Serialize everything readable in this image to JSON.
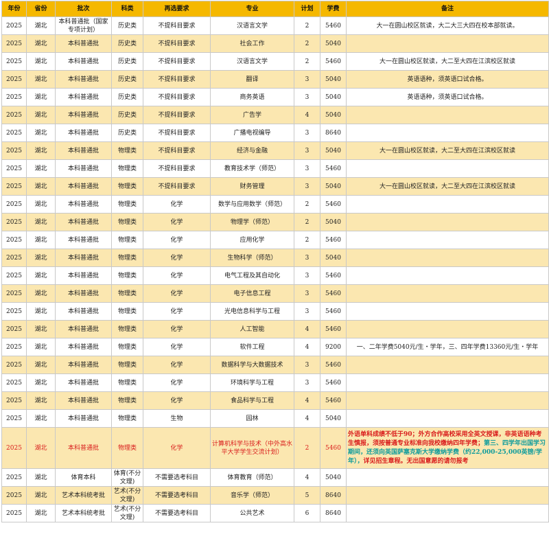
{
  "header": {
    "year": "年份",
    "province": "省份",
    "batch": "批次",
    "subject_type": "科类",
    "reselect": "再选要求",
    "major": "专业",
    "plan": "计划",
    "tuition": "学费",
    "note": "备注"
  },
  "rows": [
    {
      "year": "2025",
      "province": "湖北",
      "batch": "本科普通批（国家专项计划）",
      "subject_type": "历史类",
      "reselect": "不提科目要求",
      "major": "汉语言文学",
      "plan": "2",
      "tuition": "5460",
      "note": "大一在圆山校区就读，大二大三大四在校本部就读。"
    },
    {
      "year": "2025",
      "province": "湖北",
      "batch": "本科普通批",
      "subject_type": "历史类",
      "reselect": "不提科目要求",
      "major": "社会工作",
      "plan": "2",
      "tuition": "5040",
      "note": ""
    },
    {
      "year": "2025",
      "province": "湖北",
      "batch": "本科普通批",
      "subject_type": "历史类",
      "reselect": "不提科目要求",
      "major": "汉语言文学",
      "plan": "2",
      "tuition": "5460",
      "note": "大一在圆山校区就读，大二至大四在江滨校区就读"
    },
    {
      "year": "2025",
      "province": "湖北",
      "batch": "本科普通批",
      "subject_type": "历史类",
      "reselect": "不提科目要求",
      "major": "翻译",
      "plan": "3",
      "tuition": "5040",
      "note": "英语语种，须英语口试合格。"
    },
    {
      "year": "2025",
      "province": "湖北",
      "batch": "本科普通批",
      "subject_type": "历史类",
      "reselect": "不提科目要求",
      "major": "商务英语",
      "plan": "3",
      "tuition": "5040",
      "note": "英语语种，须英语口试合格。"
    },
    {
      "year": "2025",
      "province": "湖北",
      "batch": "本科普通批",
      "subject_type": "历史类",
      "reselect": "不提科目要求",
      "major": "广告学",
      "plan": "4",
      "tuition": "5040",
      "note": ""
    },
    {
      "year": "2025",
      "province": "湖北",
      "batch": "本科普通批",
      "subject_type": "历史类",
      "reselect": "不提科目要求",
      "major": "广播电视编导",
      "plan": "3",
      "tuition": "8640",
      "note": ""
    },
    {
      "year": "2025",
      "province": "湖北",
      "batch": "本科普通批",
      "subject_type": "物理类",
      "reselect": "不提科目要求",
      "major": "经济与金融",
      "plan": "3",
      "tuition": "5040",
      "note": "大一在圆山校区就读，大二至大四在江滨校区就读"
    },
    {
      "year": "2025",
      "province": "湖北",
      "batch": "本科普通批",
      "subject_type": "物理类",
      "reselect": "不提科目要求",
      "major": "教育技术学（师范）",
      "plan": "3",
      "tuition": "5460",
      "note": ""
    },
    {
      "year": "2025",
      "province": "湖北",
      "batch": "本科普通批",
      "subject_type": "物理类",
      "reselect": "不提科目要求",
      "major": "财务管理",
      "plan": "3",
      "tuition": "5040",
      "note": "大一在圆山校区就读，大二至大四在江滨校区就读"
    },
    {
      "year": "2025",
      "province": "湖北",
      "batch": "本科普通批",
      "subject_type": "物理类",
      "reselect": "化学",
      "major": "数学与应用数学（师范）",
      "plan": "2",
      "tuition": "5460",
      "note": ""
    },
    {
      "year": "2025",
      "province": "湖北",
      "batch": "本科普通批",
      "subject_type": "物理类",
      "reselect": "化学",
      "major": "物理学（师范）",
      "plan": "2",
      "tuition": "5040",
      "note": ""
    },
    {
      "year": "2025",
      "province": "湖北",
      "batch": "本科普通批",
      "subject_type": "物理类",
      "reselect": "化学",
      "major": "应用化学",
      "plan": "2",
      "tuition": "5460",
      "note": ""
    },
    {
      "year": "2025",
      "province": "湖北",
      "batch": "本科普通批",
      "subject_type": "物理类",
      "reselect": "化学",
      "major": "生物科学（师范）",
      "plan": "3",
      "tuition": "5040",
      "note": ""
    },
    {
      "year": "2025",
      "province": "湖北",
      "batch": "本科普通批",
      "subject_type": "物理类",
      "reselect": "化学",
      "major": "电气工程及其自动化",
      "plan": "3",
      "tuition": "5460",
      "note": ""
    },
    {
      "year": "2025",
      "province": "湖北",
      "batch": "本科普通批",
      "subject_type": "物理类",
      "reselect": "化学",
      "major": "电子信息工程",
      "plan": "3",
      "tuition": "5460",
      "note": ""
    },
    {
      "year": "2025",
      "province": "湖北",
      "batch": "本科普通批",
      "subject_type": "物理类",
      "reselect": "化学",
      "major": "光电信息科学与工程",
      "plan": "3",
      "tuition": "5460",
      "note": ""
    },
    {
      "year": "2025",
      "province": "湖北",
      "batch": "本科普通批",
      "subject_type": "物理类",
      "reselect": "化学",
      "major": "人工智能",
      "plan": "4",
      "tuition": "5460",
      "note": ""
    },
    {
      "year": "2025",
      "province": "湖北",
      "batch": "本科普通批",
      "subject_type": "物理类",
      "reselect": "化学",
      "major": "软件工程",
      "plan": "4",
      "tuition": "9200",
      "note": "一、二年学费5040元/生・学年，三、四年学费13360元/生・学年"
    },
    {
      "year": "2025",
      "province": "湖北",
      "batch": "本科普通批",
      "subject_type": "物理类",
      "reselect": "化学",
      "major": "数据科学与大数据技术",
      "plan": "3",
      "tuition": "5460",
      "note": ""
    },
    {
      "year": "2025",
      "province": "湖北",
      "batch": "本科普通批",
      "subject_type": "物理类",
      "reselect": "化学",
      "major": "环境科学与工程",
      "plan": "3",
      "tuition": "5460",
      "note": ""
    },
    {
      "year": "2025",
      "province": "湖北",
      "batch": "本科普通批",
      "subject_type": "物理类",
      "reselect": "化学",
      "major": "食品科学与工程",
      "plan": "4",
      "tuition": "5460",
      "note": ""
    },
    {
      "year": "2025",
      "province": "湖北",
      "batch": "本科普通批",
      "subject_type": "物理类",
      "reselect": "生物",
      "major": "园林",
      "plan": "4",
      "tuition": "5040",
      "note": ""
    }
  ],
  "highlight_row": {
    "year": "2025",
    "province": "湖北",
    "batch": "本科普通批",
    "subject_type": "物理类",
    "reselect": "化学",
    "major": "计算机科学与技术（中外高水平大学学生交流计划）",
    "plan": "2",
    "tuition": "5460",
    "note_part1": "外语单科成绩不低于90；外方合作高校采用全英文授课，非英语语种考生慎报，须按普通专业标准向我校缴纳四年学费；",
    "note_part2": "第三、四学年出国学习期间，还须向英国萨塞克斯大学缴纳学费（约22,000-25,000英镑/学年），",
    "note_part3": "详见招生章程。无出国意愿的请勿报考"
  },
  "bottom_rows": [
    {
      "year": "2025",
      "province": "湖北",
      "batch": "体育本科",
      "subject_type": "体育(不分文理)",
      "reselect": "不需要选考科目",
      "major": "体育教育（师范）",
      "plan": "4",
      "tuition": "5040",
      "note": ""
    },
    {
      "year": "2025",
      "province": "湖北",
      "batch": "艺术本科统考批",
      "subject_type": "艺术(不分文理)",
      "reselect": "不需要选考科目",
      "major": "音乐学（师范）",
      "plan": "5",
      "tuition": "8640",
      "note": ""
    },
    {
      "year": "2025",
      "province": "湖北",
      "batch": "艺术本科统考批",
      "subject_type": "艺术(不分文理)",
      "reselect": "不需要选考科目",
      "major": "公共艺术",
      "plan": "6",
      "tuition": "8640",
      "note": ""
    }
  ],
  "colors": {
    "header_bg": "#f5b800",
    "row_shade": "#fbe7b0",
    "highlight_text": "#d91c1c",
    "note_teal": "#0f9c9c"
  }
}
